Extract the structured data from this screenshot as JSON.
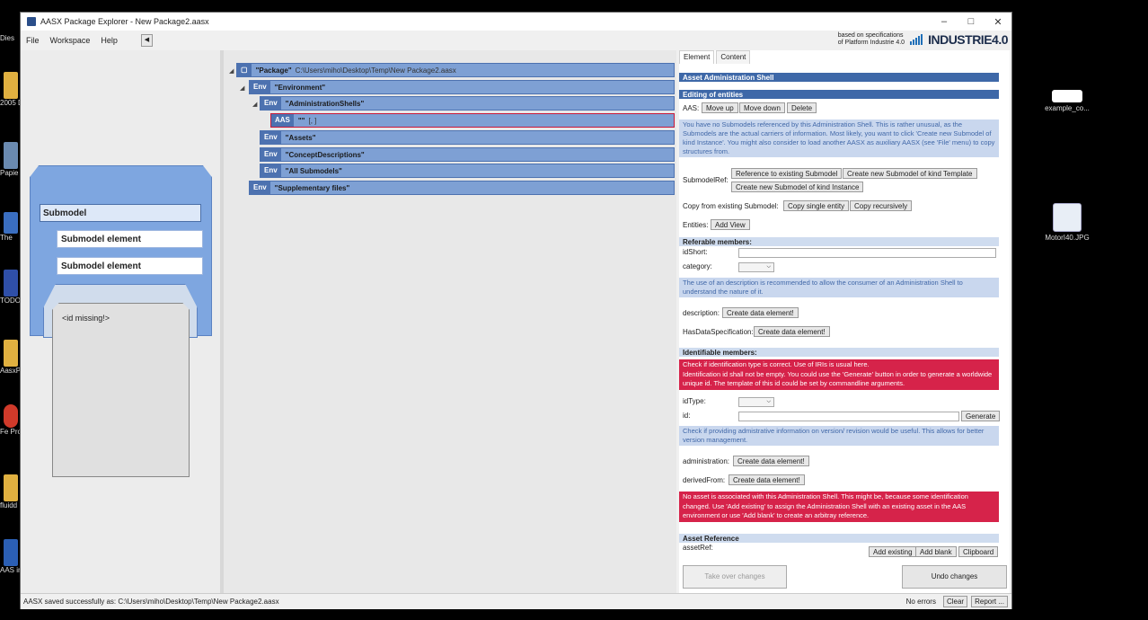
{
  "window": {
    "title": "AASX Package Explorer - New Package2.aasx"
  },
  "menu": [
    "File",
    "Workspace",
    "Help"
  ],
  "brand": {
    "spec_line1": "based on specifications",
    "spec_line2": "of Platform Industrie 4.0",
    "logo": "INDUSTRIE4.0"
  },
  "desktop": {
    "left_labels": [
      "Dies",
      "2005 Digi",
      "Papie",
      "The",
      "TODO",
      "AasxP",
      "Fe Proj",
      "fluidd",
      "AAS in Part 2"
    ],
    "right_icons": [
      {
        "label": "example_co...",
        "icon": "image-file-icon"
      },
      {
        "label": "MotorI40.JPG",
        "icon": "jpg-file-icon"
      }
    ]
  },
  "left_panel": {
    "submodel": "Submodel",
    "elements": [
      "Submodel element",
      "Submodel element"
    ],
    "id_missing": "<id missing!>"
  },
  "tree": {
    "package": {
      "tag": "▢",
      "name": "\"Package\"",
      "path": "C:\\Users\\miho\\Desktop\\Temp\\New Package2.aasx"
    },
    "environment": {
      "tag": "Env",
      "name": "\"Environment\""
    },
    "admin_shells": {
      "tag": "Env",
      "name": "\"AdministrationShells\""
    },
    "aas": {
      "tag": "AAS",
      "name": "\"\"",
      "extra": "[, ]"
    },
    "assets": {
      "tag": "Env",
      "name": "\"Assets\""
    },
    "concepts": {
      "tag": "Env",
      "name": "\"ConceptDescriptions\""
    },
    "submodels": {
      "tag": "Env",
      "name": "\"All Submodels\""
    },
    "supp": {
      "tag": "Env",
      "name": "\"Supplementary files\""
    }
  },
  "right": {
    "tabs": [
      "Element",
      "Content"
    ],
    "header": "Asset Administration Shell",
    "editing": "Editing of entities",
    "aas_label": "AAS:",
    "move_up": "Move up",
    "move_down": "Move down",
    "delete": "Delete",
    "no_submodels_info": "You have no Submodels referenced by this Administration Shell. This is rather unusual, as the Submodels are the actual carriers of information. Most likely, you want to click 'Create new Submodel of kind Instance'. You might also consider to load another AASX as auxiliary AASX (see 'File' menu) to copy structures from.",
    "submodelref_label": "SubmodelRef:",
    "ref_existing": "Reference to existing Submodel",
    "new_template": "Create new Submodel of kind Template",
    "new_instance": "Create new Submodel of kind Instance",
    "copy_label": "Copy from existing Submodel:",
    "copy_single": "Copy single entity",
    "copy_recursive": "Copy recursively",
    "entities_label": "Entities:",
    "add_view": "Add View",
    "referable_hdr": "Referable members:",
    "idshort_label": "idShort:",
    "category_label": "category:",
    "desc_info": "The use of an description is recommended to allow the consumer of an Administration Shell to understand the nature of it.",
    "description_label": "description:",
    "create_data": "Create data element!",
    "hasdataspec_label": "HasDataSpecification:",
    "identifiable_hdr": "Identifiable members:",
    "id_error": "Check if identification type is correct. Use of IRIs is usual here.\nIdentification id shall not be empty. You could use the 'Generate' button in order to generate a worldwide unique id. The template of this id could be set by commandline arguments.",
    "idtype_label": "idType:",
    "id_label": "id:",
    "generate": "Generate",
    "admin_info": "Check if providing admistrative information on version/ revision would be useful. This allows for better version management.",
    "administration_label": "administration:",
    "derivedfrom_label": "derivedFrom:",
    "asset_error": "No asset is associated with this Administration Shell. This might be, because some identification changed. Use 'Add existing' to assign the Administration Shell with an existing asset in the AAS environment or use 'Add blank' to create an arbitray reference.",
    "assetref_hdr": "Asset Reference",
    "assetref_label": "assetRef:",
    "add_existing": "Add existing",
    "add_blank": "Add blank",
    "clipboard": "Clipboard",
    "take_over": "Take over changes",
    "undo": "Undo changes"
  },
  "status": {
    "message": "AASX saved successfully as: C:\\Users\\miho\\Desktop\\Temp\\New Package2.aasx",
    "errors": "No errors",
    "clear": "Clear",
    "report": "Report ..."
  }
}
